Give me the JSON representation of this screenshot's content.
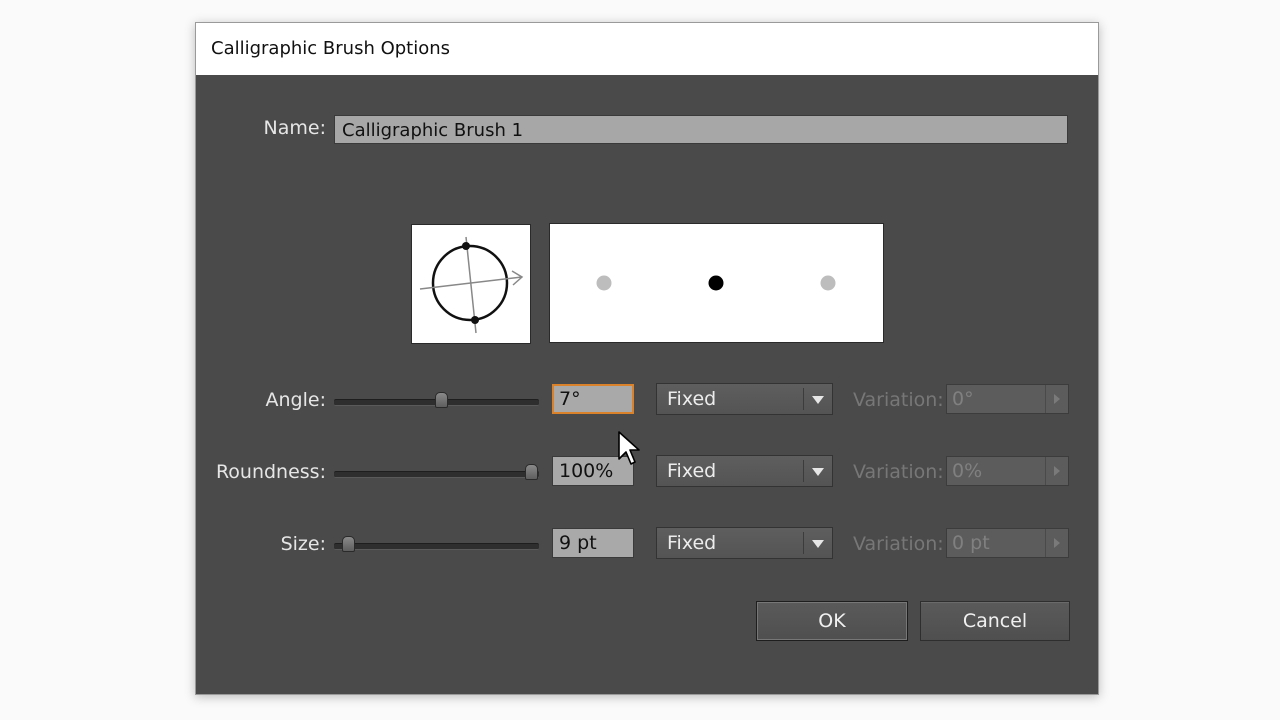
{
  "dialog": {
    "title": "Calligraphic Brush Options"
  },
  "name": {
    "label": "Name:",
    "value": "Calligraphic Brush 1"
  },
  "rows": [
    {
      "label": "Angle:",
      "value": "7°",
      "slider_fraction": 0.52,
      "mode": "Fixed",
      "variation_label": "Variation:",
      "variation_value": "0°"
    },
    {
      "label": "Roundness:",
      "value": "100%",
      "slider_fraction": 0.96,
      "mode": "Fixed",
      "variation_label": "Variation:",
      "variation_value": "0%"
    },
    {
      "label": "Size:",
      "value": "9 pt",
      "slider_fraction": 0.07,
      "mode": "Fixed",
      "variation_label": "Variation:",
      "variation_value": "0 pt"
    }
  ],
  "buttons": {
    "ok": "OK",
    "cancel": "Cancel"
  },
  "colors": {
    "dialog_bg": "#4a4a4a",
    "focus_ring": "#d9822b"
  }
}
